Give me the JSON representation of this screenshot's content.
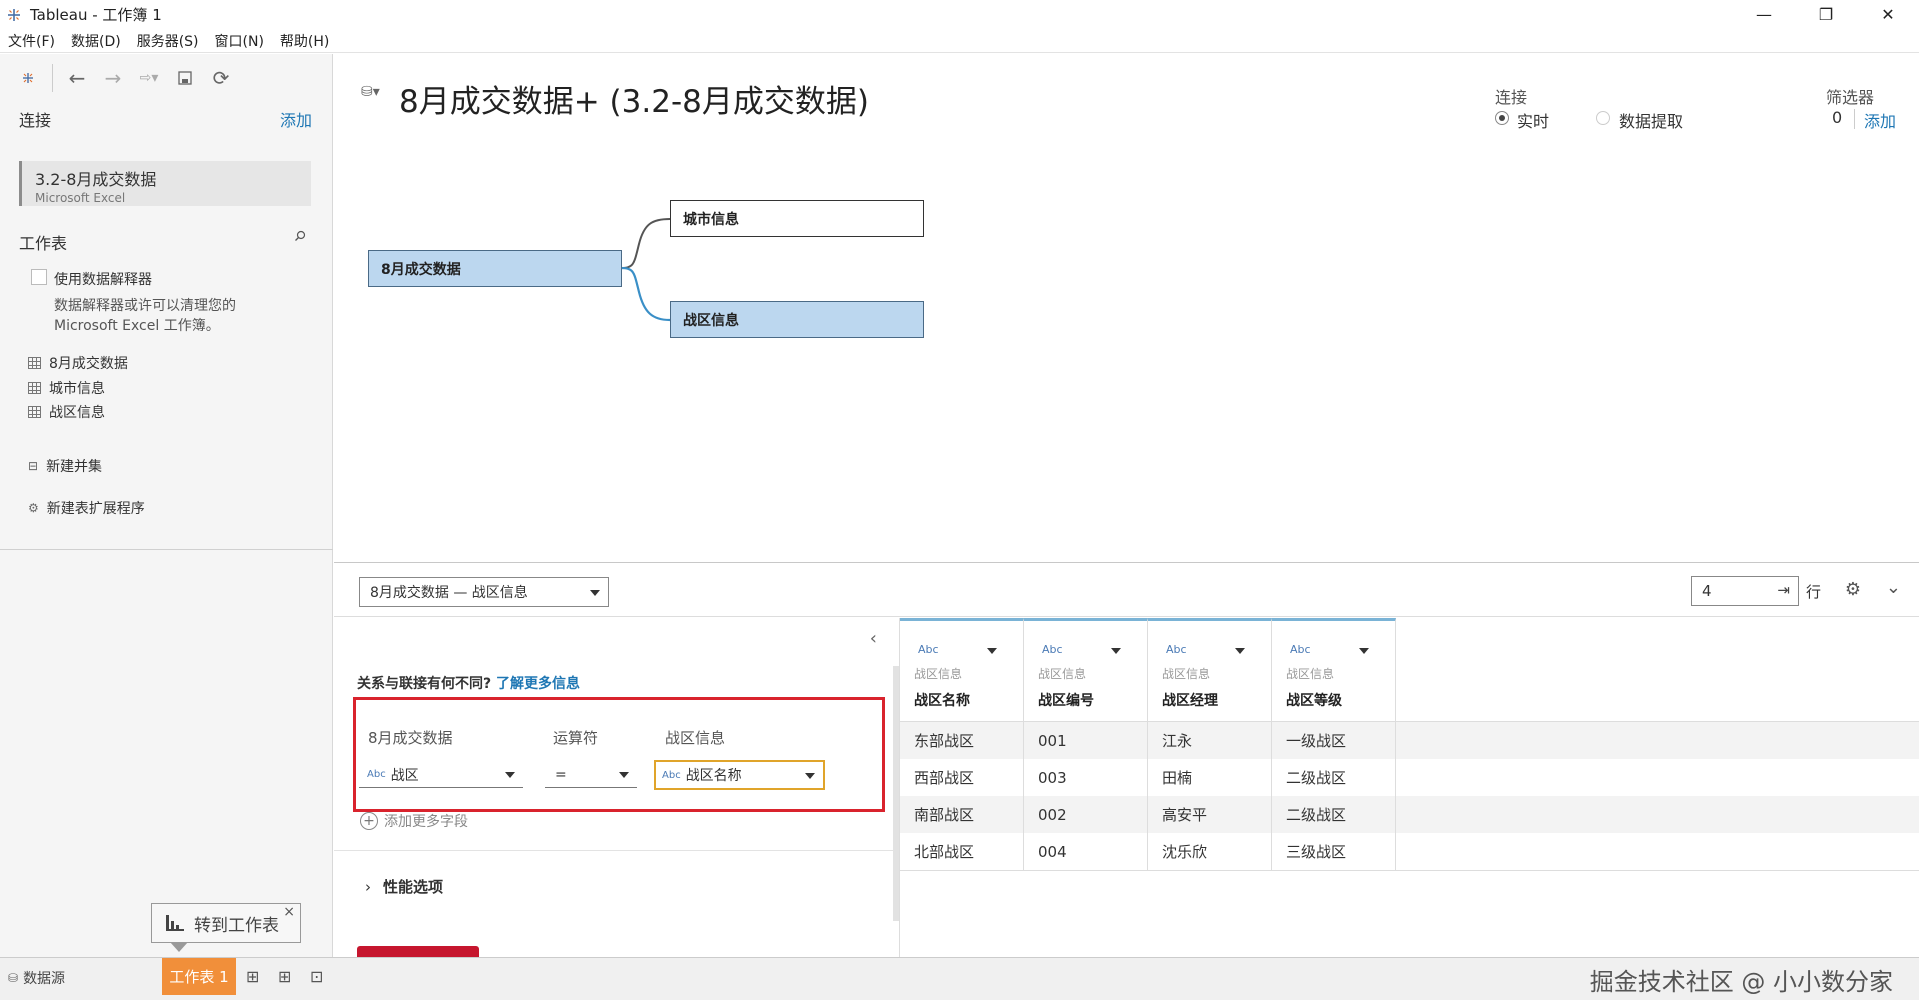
{
  "window": {
    "title": "Tableau - 工作簿 1",
    "minimize": "—",
    "restore": "❐",
    "close": "✕"
  },
  "menu": [
    "文件(F)",
    "数据(D)",
    "服务器(S)",
    "窗口(N)",
    "帮助(H)"
  ],
  "sidebar": {
    "connections_label": "连接",
    "add_label": "添加",
    "connection": {
      "name": "3.2-8月成交数据",
      "type": "Microsoft Excel"
    },
    "worksheets_label": "工作表",
    "interpreter_label": "使用数据解释器",
    "interpreter_desc_line1": "数据解释器或许可以清理您的",
    "interpreter_desc_line2": "Microsoft Excel 工作簿。",
    "tables": [
      "8月成交数据",
      "城市信息",
      "战区信息"
    ],
    "new_union": "新建并集",
    "new_extension": "新建表扩展程序"
  },
  "canvas": {
    "title": "8月成交数据+ (3.2-8月成交数据)",
    "connection_label": "连接",
    "live_label": "实时",
    "extract_label": "数据提取",
    "filters_label": "筛选器",
    "filters_count": "0",
    "filters_add": "添加",
    "nodes": {
      "root": "8月成交数据",
      "child1": "城市信息",
      "child2": "战区信息"
    }
  },
  "relation_bar": {
    "selected": "8月成交数据 — 战区信息",
    "rows_value": "4",
    "rows_label": "行"
  },
  "relation_panel": {
    "hint": "关系与联接有何不同?",
    "hint_link": "了解更多信息",
    "left_label": "8月成交数据",
    "operator_label": "运算符",
    "right_label": "战区信息",
    "left_field": "战区",
    "operator": "=",
    "right_field": "战区名称",
    "add_more": "添加更多字段",
    "perf_label": "性能选项"
  },
  "grid": {
    "type_tag": "Abc",
    "columns": [
      {
        "source": "战区信息",
        "name": "战区名称"
      },
      {
        "source": "战区信息",
        "name": "战区编号"
      },
      {
        "source": "战区信息",
        "name": "战区经理"
      },
      {
        "source": "战区信息",
        "name": "战区等级"
      }
    ],
    "rows": [
      [
        "东部战区",
        "001",
        "江永",
        "一级战区"
      ],
      [
        "西部战区",
        "003",
        "田楠",
        "二级战区"
      ],
      [
        "南部战区",
        "002",
        "高安平",
        "二级战区"
      ],
      [
        "北部战区",
        "004",
        "沈乐欣",
        "三级战区"
      ]
    ]
  },
  "tabs": {
    "datasource": "数据源",
    "sheet1": "工作表 1"
  },
  "tooltip": {
    "text": "转到工作表"
  },
  "watermark": "掘金技术社区 @ 小小数分家"
}
